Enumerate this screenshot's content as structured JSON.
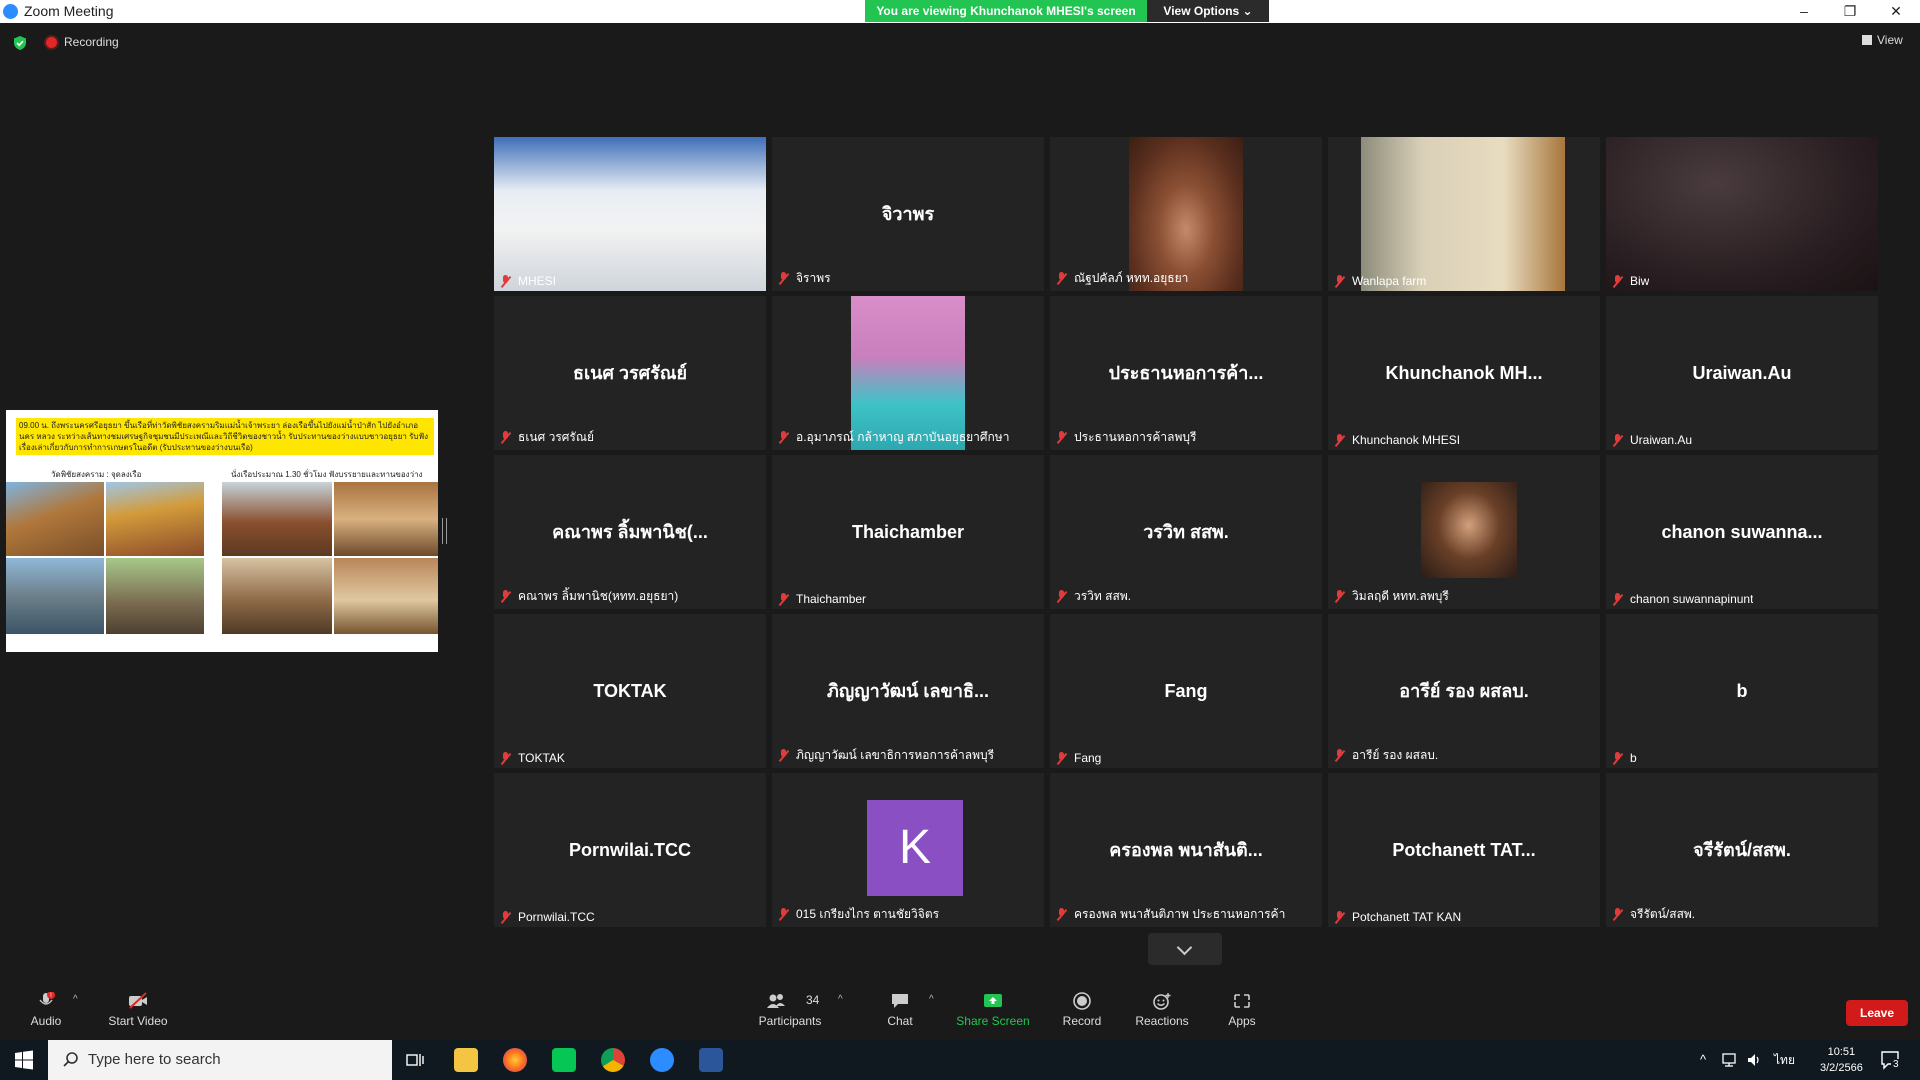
{
  "window": {
    "title": "Zoom Meeting",
    "viewing_banner": "You are viewing Khunchanok MHESI's screen",
    "view_options": "View Options ⌄",
    "controls": [
      "–",
      "❐",
      "✕"
    ]
  },
  "status": {
    "recording_label": "Recording",
    "view_label": "View"
  },
  "shared_screen": {
    "headline": "09.00 น. ถึงพระนครศรีอยุธยา ขึ้นเรือที่ท่าวัดพิชัยสงครามริมแม่น้ำเจ้าพระยา ล่องเรือขึ้นไปยังแม่น้ำป่าสัก ไปยังอำเภอนคร หลวง ระหว่างเส้นทางชมเศรษฐกิจชุมชนมีประเพณีและวิถีชีวิตของชาวน้ำ รับประทานของว่างแบบชาวอยุธยา รับฟังเรื่องเล่าเกี่ยวกับการทำการเกษตรในอดีต (รับประทานของว่างบนเรือ)",
    "caption_left": "วัดพิชัยสงคราม : จุดลงเรือ",
    "caption_right": "นั่งเรือประมาณ 1.30 ชั่วโมง ฟังบรรยายและทานของว่าง"
  },
  "participants": [
    {
      "display": "",
      "label": "MHESI",
      "video": "room",
      "active": true
    },
    {
      "display": "จิวาพร",
      "label": "จิราพร"
    },
    {
      "display": "",
      "label": "ณัฐปคัลภ์ หทท.อยุธยา",
      "video": "man"
    },
    {
      "display": "",
      "label": "Wanlapa farm",
      "video": "room2"
    },
    {
      "display": "",
      "label": "Biw",
      "video": "dark"
    },
    {
      "display": "ธเนศ วรศรัณย์",
      "label": "ธเนศ วรศรัณย์"
    },
    {
      "display": "",
      "label": "อ.อุมาภรณ์ กล้าหาญ สภาบันอยุธยาศึกษา",
      "video": "woman"
    },
    {
      "display": "ประธานหอการค้า...",
      "label": "ประธานหอการค้าลพบุรี"
    },
    {
      "display": "Khunchanok  MH...",
      "label": "Khunchanok MHESI"
    },
    {
      "display": "Uraiwan.Au",
      "label": "Uraiwan.Au"
    },
    {
      "display": "คณาพร ลิ้มพานิช(...",
      "label": "คณาพร ลิ้มพานิช(หทท.อยุธยา)"
    },
    {
      "display": "Thaichamber",
      "label": "Thaichamber"
    },
    {
      "display": "วรวิท สสพ.",
      "label": "วรวิท สสพ."
    },
    {
      "display": "",
      "label": "วิมลฤดี หทท.ลพบุรี",
      "video": "woman2"
    },
    {
      "display": "chanon  suwanna...",
      "label": "chanon suwannapinunt"
    },
    {
      "display": "TOKTAK",
      "label": "TOKTAK"
    },
    {
      "display": "ภิญญาวัฒน์ เลขาธิ...",
      "label": "ภิญญาวัฒน์ เลขาธิการหอการค้าลพบุรี"
    },
    {
      "display": "Fang",
      "label": "Fang"
    },
    {
      "display": "อารีย์ รอง ผสลบ.",
      "label": "อารีย์ รอง ผสลบ."
    },
    {
      "display": "b",
      "label": "b"
    },
    {
      "display": "Pornwilai.TCC",
      "label": "Pornwilai.TCC"
    },
    {
      "display": "",
      "label": "015 เกรียงไกร ตานชัยวิจิตร",
      "avatar_letter": "K"
    },
    {
      "display": "ครองพล พนาสันติ...",
      "label": "ครองพล พนาสันติภาพ ประธานหอการค้า"
    },
    {
      "display": "Potchanett   TAT...",
      "label": "Potchanett  TAT KAN"
    },
    {
      "display": "จรีรัตน์/สสพ.",
      "label": "จรีรัตน์/สสพ."
    }
  ],
  "toolbar": {
    "audio": "Audio",
    "start_video": "Start Video",
    "participants": "Participants",
    "participants_count": "34",
    "chat": "Chat",
    "share_screen": "Share Screen",
    "record": "Record",
    "reactions": "Reactions",
    "apps": "Apps",
    "leave": "Leave"
  },
  "taskbar": {
    "search_placeholder": "Type here to search",
    "language": "ไทย",
    "time": "10:51",
    "date": "3/2/2566",
    "notification_count": "3"
  },
  "colors": {
    "banner_green": "#23c552",
    "active_outline": "#f5e94a",
    "leave_red": "#d21a1a",
    "avatar_purple": "#8a4fc2"
  }
}
